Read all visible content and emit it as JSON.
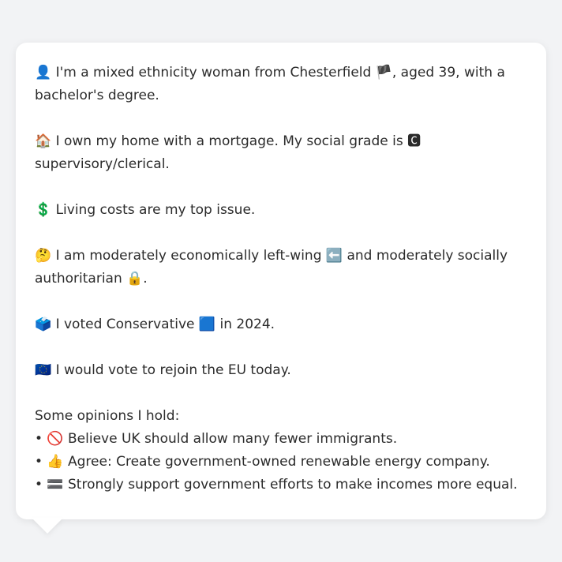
{
  "persona": {
    "identity": "👤 I'm a mixed ethnicity woman from Chesterfield 🏴, aged 39, with a bachelor's degree.",
    "home": "🏠 I own my home with a mortgage. My social grade is 🅲 supervisory/clerical.",
    "top_issue": "💲 Living costs are my top issue.",
    "ideology": "🤔 I am moderately economically left-wing ⬅️ and moderately socially authoritarian 🔒.",
    "vote": "🗳️ I voted Conservative 🟦 in 2024.",
    "eu": "🇪🇺 I would vote to rejoin the EU today."
  },
  "opinions": {
    "heading": "Some opinions I hold:",
    "items": [
      "• 🚫 Believe UK should allow many fewer immigrants.",
      "• 👍 Agree: Create government-owned renewable energy company.",
      "• 🟰 Strongly support government efforts to make incomes more equal."
    ]
  }
}
